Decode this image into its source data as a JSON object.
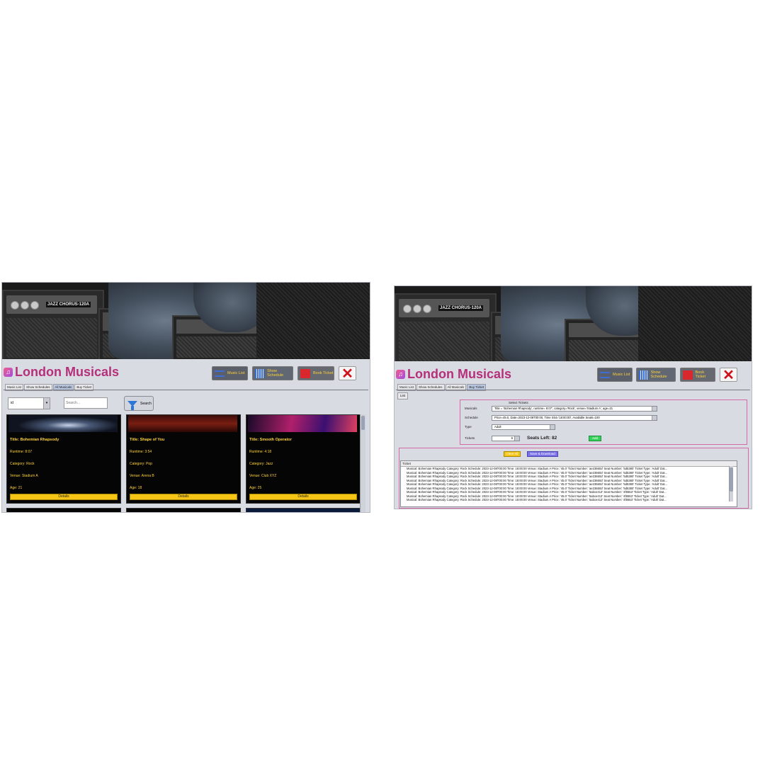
{
  "left": {
    "app_title": "London Musicals",
    "header_buttons": {
      "music": "Music List",
      "show": "Show Schedule",
      "book": "Book Ticket"
    },
    "tabs": [
      "Music List",
      "Show Schedules",
      "All Musicals",
      "Buy Ticket"
    ],
    "selected_tab": "All Musicals",
    "filter": {
      "field": "id",
      "search_placeholder": "Search...",
      "search_button": "Search"
    },
    "cards": [
      {
        "title": "Title: Bohemian Rhapsody",
        "runtime": "Runtime: 8:07",
        "category": "Category: Rock",
        "venue": "Venue: Stadium A",
        "age": "Age: 21",
        "details": "Details"
      },
      {
        "title": "Title: Shape of You",
        "runtime": "Runtime: 3:54",
        "category": "Category: Pop",
        "venue": "Venue: Arena B",
        "age": "Age: 18",
        "details": "Details"
      },
      {
        "title": "Title: Smooth Operator",
        "runtime": "Runtime: 4:18",
        "category": "Category: Jazz",
        "venue": "Venue: Club XYZ",
        "age": "Age: 25",
        "details": "Details"
      }
    ]
  },
  "right": {
    "app_title": "London Musicals",
    "header_buttons": {
      "music": "Music List",
      "show": "Show Schedule",
      "book": "Book Ticket"
    },
    "tabs": [
      "Music List",
      "Show Schedules",
      "All Musicals",
      "Buy Ticket"
    ],
    "selected_tab": "Buy Ticket",
    "sub_tab": "List",
    "select_caption": "Select Tickets",
    "musicals_label": "Musicals",
    "musicals_value": "Title = 'Bohemian Rhapsody', runtime= 8:07', category='Rock', venue='Stadium A', age=21",
    "schedule_label": "Schedule",
    "schedule_value": "Price=45.0, Date=2023-12-08T00:00, Time Slot='18:00:00', Available Seats=100",
    "type_label": "Type",
    "type_value": "Adult",
    "tickets_label": "Tickets",
    "tickets_value": "6",
    "seats_left": "Seats Left: 82",
    "add": "Add",
    "clear_all": "Clear All",
    "save_download": "Save & Download",
    "table_header": "Ticket",
    "rows": [
      "Musical: Bohemian Rhapsody Category: Rock   Schedule: 2023-12-08T00:00 Time: 18:00:00   Venue: Stadium A   Price: '45.0'   Ticket Number: 'ae23660d'   Seat Number: '5d5380'   Ticket Type: 'Adult'   Dat...",
      "Musical: Bohemian Rhapsody Category: Rock   Schedule: 2023-12-08T00:00 Time: 18:00:00   Venue: Stadium A   Price: '45.0'   Ticket Number: 'ae23660d'   Seat Number: '5d5380'   Ticket Type: 'Adult'   Dat...",
      "Musical: Bohemian Rhapsody Category: Rock   Schedule: 2023-12-08T00:00 Time: 18:00:00   Venue: Stadium A   Price: '45.0'   Ticket Number: 'ae23660d'   Seat Number: '5d5380'   Ticket Type: 'Adult'   Dat...",
      "Musical: Bohemian Rhapsody Category: Rock   Schedule: 2023-12-08T00:00 Time: 18:00:00   Venue: Stadium A   Price: '45.0'   Ticket Number: 'ae23660d'   Seat Number: '5d5380'   Ticket Type: 'Adult'   Dat...",
      "Musical: Bohemian Rhapsody Category: Rock   Schedule: 2023-12-08T00:00 Time: 18:00:00   Venue: Stadium A   Price: '45.0'   Ticket Number: 'ae23660d'   Seat Number: '5d5380'   Ticket Type: 'Adult'   Dat...",
      "Musical: Bohemian Rhapsody Category: Rock   Schedule: 2023-12-08T00:00 Time: 18:00:00   Venue: Stadium A   Price: '45.0'   Ticket Number: 'ae23660d'   Seat Number: '5d5380'   Ticket Type: 'Adult'   Dat...",
      "Musical: Bohemian Rhapsody Category: Rock   Schedule: 2023-12-08T00:00 Time: 18:00:00   Venue: Stadium A   Price: '45.0'   Ticket Number: '5abce413'   Seat Number: '4f6553'   Ticket Type: 'Adult'   Dat...",
      "Musical: Bohemian Rhapsody Category: Rock   Schedule: 2023-12-08T00:00 Time: 18:00:00   Venue: Stadium A   Price: '45.0'   Ticket Number: '5abce413'   Seat Number: '4f6553'   Ticket Type: 'Adult'   Dat...",
      "Musical: Bohemian Rhapsody Category: Rock   Schedule: 2023-12-08T00:00 Time: 18:00:00   Venue: Stadium A   Price: '45.0'   Ticket Number: '5abce413'   Seat Number: '4f6553'   Ticket Type: 'Adult'   Dat..."
    ]
  },
  "colors": {
    "title": "#b5307a",
    "accent_yellow": "#ffd23a",
    "details_yellow": "#f6c515",
    "close_red": "#d0101a",
    "add_green": "#35d25a",
    "save_purple": "#7b72e8",
    "panel_border": "#d46aa6"
  }
}
